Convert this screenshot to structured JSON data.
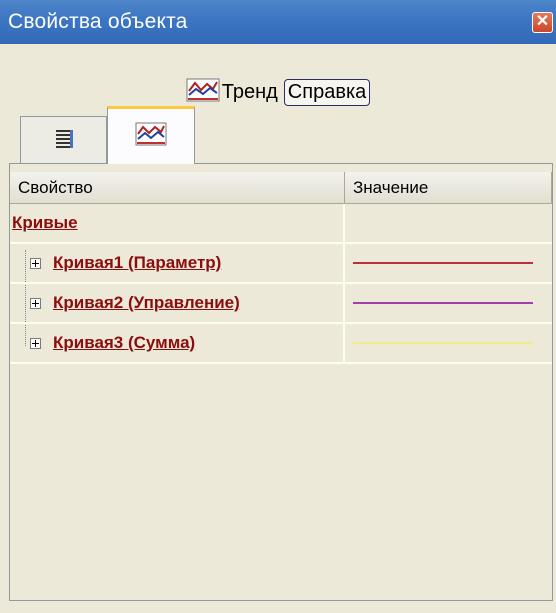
{
  "window": {
    "title": "Свойства объекта",
    "close_glyph": "✕"
  },
  "toolbar": {
    "trend_label": "Тренд",
    "help_label": "Справка",
    "trend_icon": "trend-icon"
  },
  "tabs": [
    {
      "icon": "list-icon",
      "selected": false
    },
    {
      "icon": "trend-icon",
      "selected": true
    }
  ],
  "grid": {
    "col_property": "Свойство",
    "col_value": "Значение",
    "rows": [
      {
        "label": "Кривые",
        "expandable": false,
        "line_color": null
      },
      {
        "label": "Кривая1 (Параметр)",
        "expandable": true,
        "line_color": "#b8303a"
      },
      {
        "label": "Кривая2 (Управление)",
        "expandable": true,
        "line_color": "#a040a8"
      },
      {
        "label": "Кривая3 (Сумма)",
        "expandable": true,
        "line_color": "#f2ec86"
      }
    ]
  },
  "colors": {
    "titlebar": "#3d77c4",
    "label": "#8b0d0d",
    "background": "#ece9d8"
  }
}
